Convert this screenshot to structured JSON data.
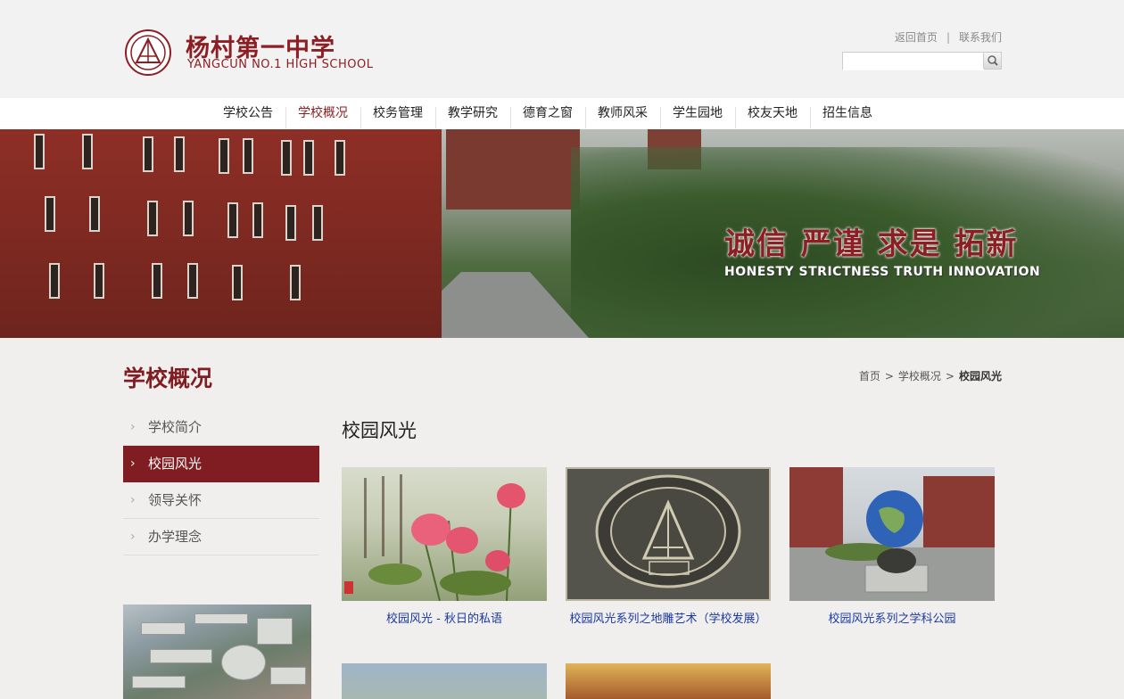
{
  "header": {
    "logo_cn": "杨村第一中学",
    "logo_en": "YANGCUN NO.1 HIGH SCHOOL",
    "links": [
      "返回首页",
      "联系我们"
    ],
    "search": {
      "placeholder": "",
      "value": ""
    }
  },
  "nav": {
    "items": [
      "学校公告",
      "学校概况",
      "校务管理",
      "教学研究",
      "德育之窗",
      "教师风采",
      "学生园地",
      "校友天地",
      "招生信息"
    ],
    "active_index": 1
  },
  "banner": {
    "motto_cn": "诚信  严谨  求是  拓新",
    "motto_en": "HONESTY  STRICTNESS  TRUTH  INNOVATION"
  },
  "section": {
    "title": "学校概况",
    "breadcrumb": [
      "首页",
      "学校概况",
      "校园风光"
    ]
  },
  "sidebar": {
    "items": [
      "学校简介",
      "校园风光",
      "领导关怀",
      "办学理念"
    ],
    "active_index": 1
  },
  "content": {
    "title": "校园风光",
    "gallery": [
      {
        "caption": "校园风光 - 秋日的私语"
      },
      {
        "caption": "校园风光系列之地雕艺术（学校发展）"
      },
      {
        "caption": "校园风光系列之学科公园"
      }
    ]
  },
  "colors": {
    "brand": "#7f1d22",
    "link": "#1a3aa0"
  }
}
